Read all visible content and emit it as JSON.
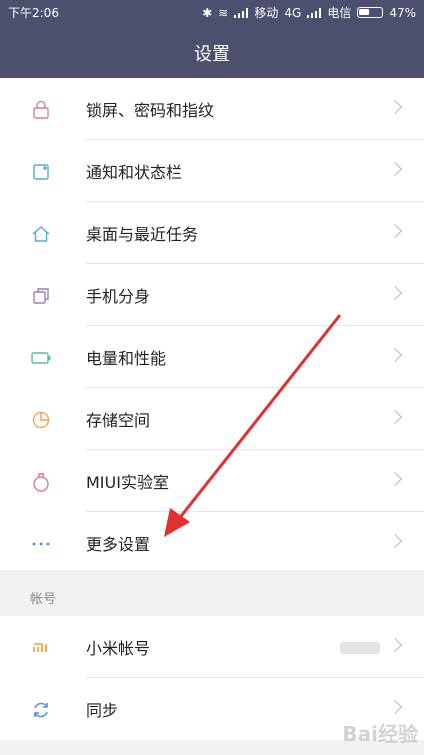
{
  "status": {
    "time": "下午2:06",
    "carrier1": "移动",
    "network": "4G",
    "carrier2": "电信",
    "battery": "47%"
  },
  "header": {
    "title": "设置"
  },
  "settings": [
    {
      "label": "锁屏、密码和指纹",
      "icon": "lock-icon",
      "color": "#e37b8b"
    },
    {
      "label": "通知和状态栏",
      "icon": "notification-icon",
      "color": "#4bb3c6"
    },
    {
      "label": "桌面与最近任务",
      "icon": "home-icon",
      "color": "#4bb3c6"
    },
    {
      "label": "手机分身",
      "icon": "clone-icon",
      "color": "#9b7dc8"
    },
    {
      "label": "电量和性能",
      "icon": "battery-icon",
      "color": "#55c19a"
    },
    {
      "label": "存储空间",
      "icon": "storage-icon",
      "color": "#f0a35a"
    },
    {
      "label": "MIUI实验室",
      "icon": "flask-icon",
      "color": "#e37b8b"
    },
    {
      "label": "更多设置",
      "icon": "more-icon",
      "color": "#4b8fd6"
    }
  ],
  "account_section": {
    "title": "帐号"
  },
  "accounts": [
    {
      "label": "小米帐号",
      "icon": "mi-icon",
      "color": "#f39b24"
    },
    {
      "label": "同步",
      "icon": "sync-icon",
      "color": "#4b8fd6"
    }
  ],
  "watermark": "Bai经验"
}
